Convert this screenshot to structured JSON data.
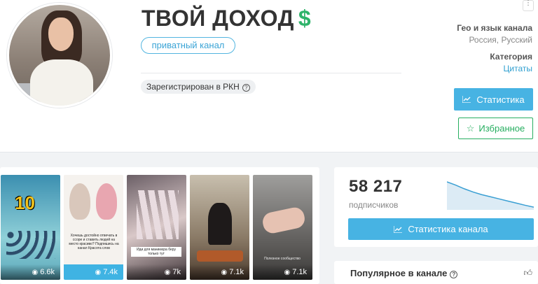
{
  "channel": {
    "title": "ТВОЙ ДОХОД",
    "title_icon": "$",
    "private_label": "приватный канал",
    "rkn_label": "Зарегистрирован в РКН",
    "help_glyph": "?"
  },
  "meta": {
    "geo_label": "Гео и язык канала",
    "geo_value": "Россия, Русский",
    "category_label": "Категория",
    "category_value": "Цитаты"
  },
  "buttons": {
    "stats": "Статистика",
    "favorites": "Избранное",
    "channel_stats": "Статистика канала"
  },
  "posts": [
    {
      "views": "6.6k",
      "caption": "10"
    },
    {
      "views": "7.4k",
      "caption": "Хочешь достойно отвечать в ссоре и ставить людей на место красиво? Подпишись на канал Красота слов"
    },
    {
      "views": "7k",
      "caption": "Иди для маникюра беру только тут"
    },
    {
      "views": "7.1k",
      "caption": ""
    },
    {
      "views": "7.1k",
      "caption": "Полезное сообщество"
    }
  ],
  "subscribers": {
    "count": "58 217",
    "label": "подписчиков",
    "trend": [
      1.0,
      0.88,
      0.74,
      0.62,
      0.52,
      0.44,
      0.36,
      0.28,
      0.2,
      0.12,
      0.05
    ]
  },
  "popular": {
    "title": "Популярное в канале"
  },
  "colors": {
    "accent": "#47b3e3",
    "green": "#27ae60",
    "dollar": "#2fb36a"
  },
  "icons": {
    "stats": "chart-icon",
    "favorite": "star-icon",
    "views": "eye-icon",
    "like": "thumbs-up-icon",
    "more": "more-dots-icon"
  }
}
